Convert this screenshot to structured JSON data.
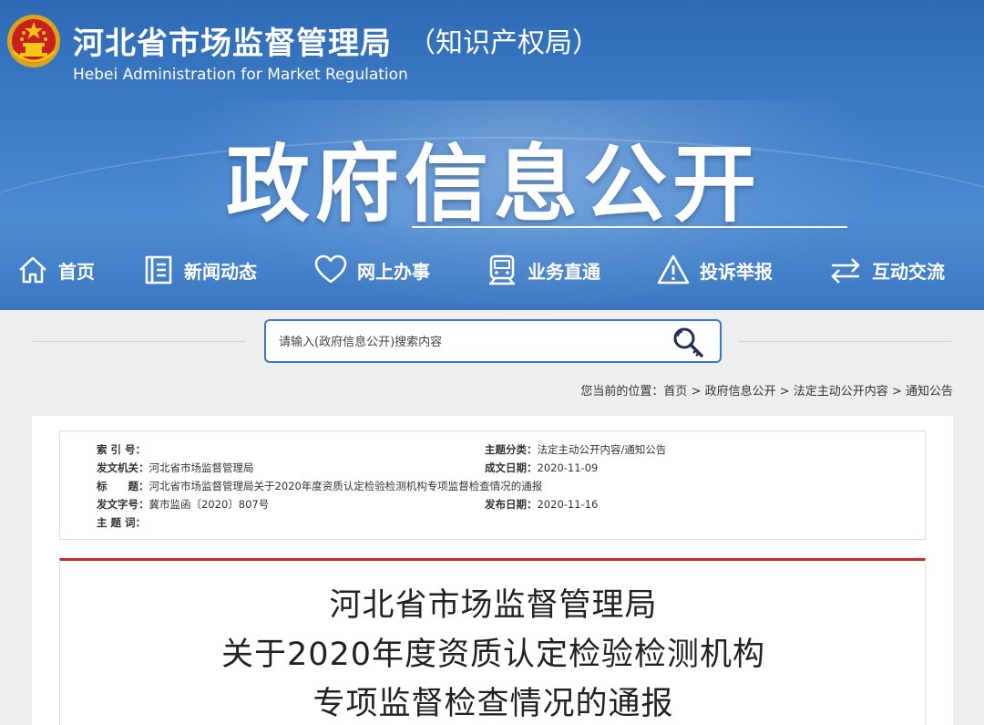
{
  "header": {
    "org_name_cn": "河北省市场监督管理局",
    "org_name_sub": "（知识产权局）",
    "org_name_en": "Hebei Administration for Market Regulation",
    "hero_title": "政府信息公开"
  },
  "nav": {
    "items": [
      {
        "label": "首页",
        "icon": "home-icon"
      },
      {
        "label": "新闻动态",
        "icon": "news-list-icon"
      },
      {
        "label": "网上办事",
        "icon": "heart-icon"
      },
      {
        "label": "业务直通",
        "icon": "train-icon"
      },
      {
        "label": "投诉举报",
        "icon": "warning-icon"
      },
      {
        "label": "互动交流",
        "icon": "exchange-arrows-icon"
      }
    ]
  },
  "search": {
    "placeholder": "请输入(政府信息公开)搜索内容",
    "icon": "search-key-icon"
  },
  "breadcrumb": {
    "prefix": "您当前的位置：",
    "items": [
      "首页",
      "政府信息公开",
      "法定主动公开内容",
      "通知公告"
    ],
    "separator": " > "
  },
  "meta": {
    "index_label": "索 引 号：",
    "index_value": "",
    "issuer_label": "发文机关：",
    "issuer_value": "河北省市场监督管理局",
    "title_label": "标　　题：",
    "title_value": "河北省市场监督管理局关于2020年度资质认定检验检测机构专项监督检查情况的通报",
    "docno_label": "发文字号：",
    "docno_value": "冀市监函〔2020〕807号",
    "keywords_label": "主 题 词：",
    "keywords_value": "",
    "category_label": "主题分类：",
    "category_value": "法定主动公开内容/通知公告",
    "created_label": "成文日期：",
    "created_value": "2020-11-09",
    "published_label": "发布日期：",
    "published_value": "2020-11-16"
  },
  "document": {
    "title_lines": [
      "河北省市场监督管理局",
      "关于2020年度资质认定检验检测机构",
      "专项监督检查情况的通报"
    ]
  },
  "colors": {
    "banner_blue": "#3f7ec9",
    "search_border": "#3b75bd",
    "doc_top_rule": "#cc2a2a"
  }
}
